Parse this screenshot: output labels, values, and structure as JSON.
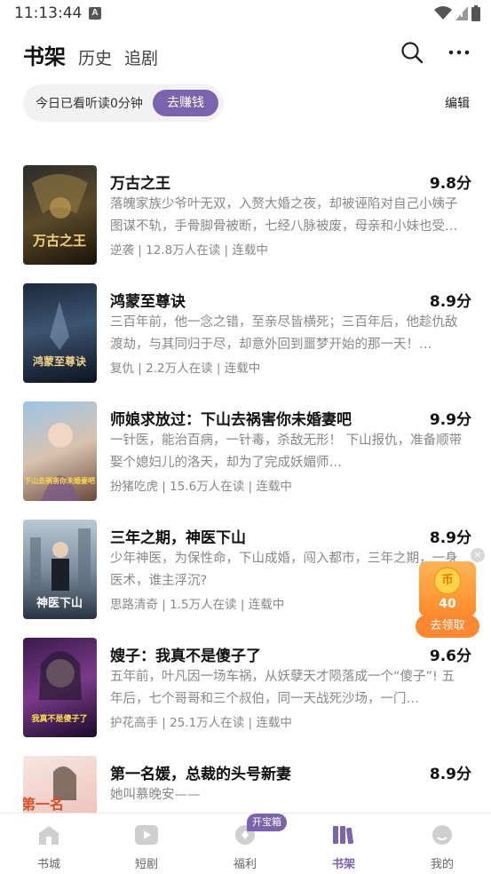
{
  "status_bar": {
    "time": "11:13:44",
    "a_badge": "A"
  },
  "tabs": [
    {
      "label": "书架",
      "active": true
    },
    {
      "label": "历史",
      "active": false
    },
    {
      "label": "追剧",
      "active": false
    }
  ],
  "reading": {
    "text": "今日已看听读0分钟",
    "earn_label": "去赚钱"
  },
  "edit_label": "编辑",
  "books": [
    {
      "title": "万古之王",
      "score": "9.8分",
      "desc": "落魄家族少爷叶无双，入赘大婚之夜，却被诬陷对自己小姨子图谋不轨，手骨脚骨被断，七经八脉被废，母亲和小妹也受…",
      "meta": "逆袭 | 12.8万人在读 | 连载中",
      "cover_text": "万古之王"
    },
    {
      "title": "鸿蒙至尊诀",
      "score": "8.9分",
      "desc": "三百年前，他一念之错，至亲尽皆横死；三百年后，他趁仇敌渡劫，与其同归于尽，却意外回到噩梦开始的那一天！…",
      "meta": "复仇 | 2.2万人在读 | 连载中",
      "cover_text": "鸿蒙至尊诀"
    },
    {
      "title": "师娘求放过：下山去祸害你未婚妻吧",
      "score": "9.9分",
      "desc": "一针医，能治百病，一针毒，杀敌无形！ 下山报仇，准备顺带娶个媳妇儿的洛天，却为了完成妖媚师…",
      "meta": "扮猪吃虎 | 15.6万人在读 | 连载中",
      "cover_text": "下山去祸害你未婚妻吧"
    },
    {
      "title": "三年之期，神医下山",
      "score": "8.9分",
      "desc": "少年神医，为保性命，下山成婚，闯入都市，三年之期，一身医术，谁主浮沉?",
      "meta": "思路清奇 | 1.5万人在读 | 连载中",
      "cover_text": "神医下山"
    },
    {
      "title": "嫂子：我真不是傻子了",
      "score": "9.6分",
      "desc": "五年前，叶凡因一场车祸，从妖孽天才陨落成一个“傻子”! 五年后，七个哥哥和三个叔伯，同一天战死沙场，一门…",
      "meta": "护花高手 | 25.1万人在读 | 连载中",
      "cover_text": "我真不是傻子了"
    },
    {
      "title": "第一名媛，总裁的头号新妻",
      "score": "8.9分",
      "desc": "她叫慕晚安——",
      "meta": "",
      "cover_text": "第一名"
    }
  ],
  "reward": {
    "coin_symbol": "币",
    "amount": "40",
    "button_label": "去领取",
    "close": "×"
  },
  "bottom_nav": [
    {
      "label": "书城",
      "icon": "home-icon",
      "active": false
    },
    {
      "label": "短剧",
      "icon": "play-icon",
      "active": false
    },
    {
      "label": "福利",
      "icon": "gift-icon",
      "active": false,
      "badge": "开宝箱"
    },
    {
      "label": "书架",
      "icon": "bookshelf-icon",
      "active": true
    },
    {
      "label": "我的",
      "icon": "profile-icon",
      "active": false
    }
  ],
  "colors": {
    "accent": "#7c63ad",
    "reward_orange": "#ff8830"
  }
}
